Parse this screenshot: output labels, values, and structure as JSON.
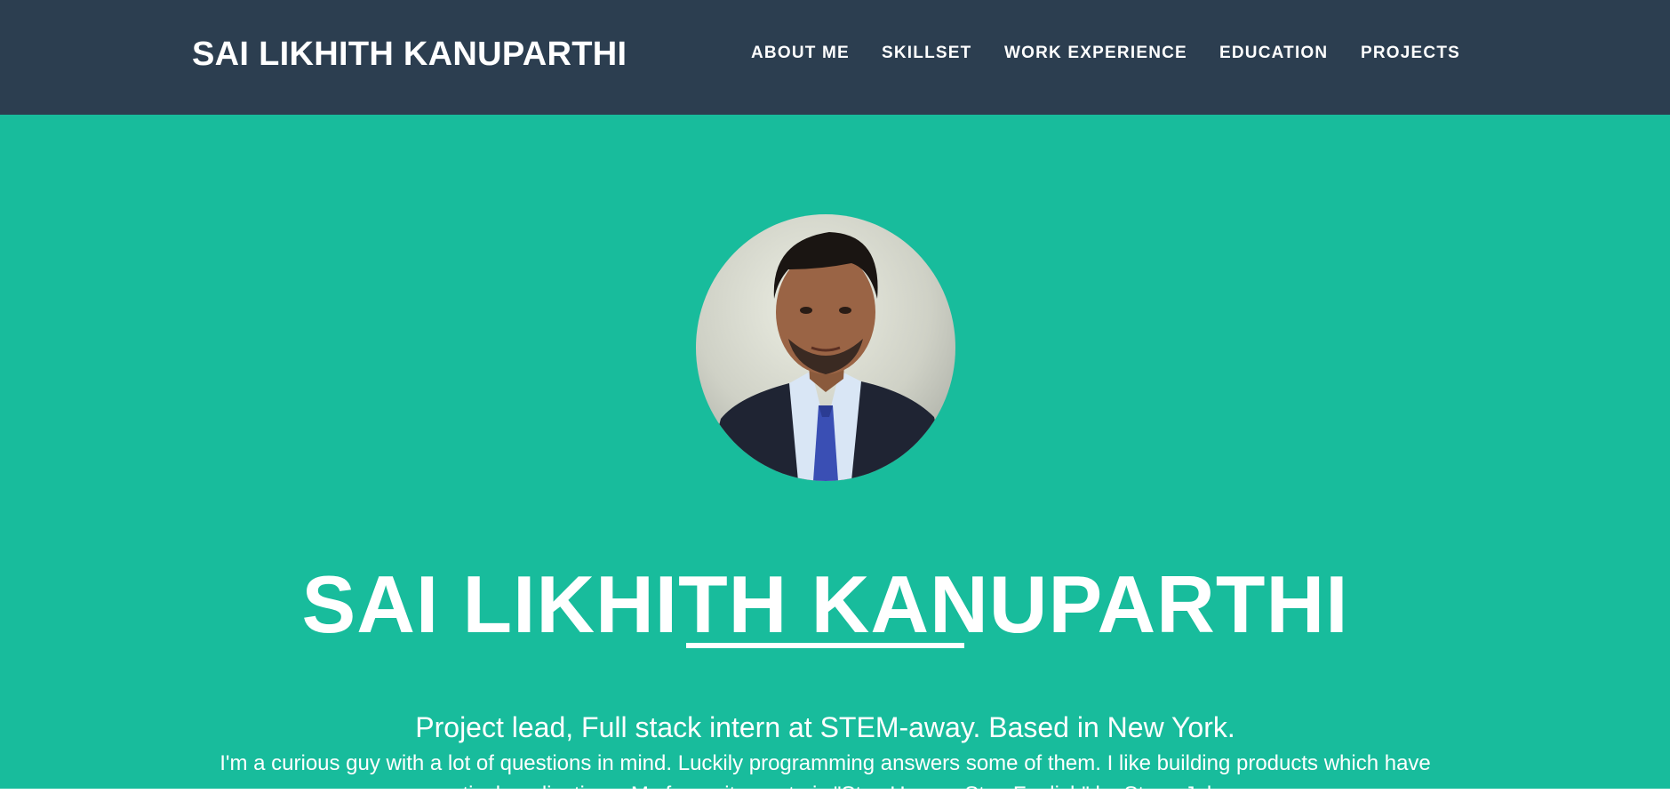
{
  "navbar": {
    "brand": "SAI LIKHITH KANUPARTHI",
    "links": [
      {
        "label": "ABOUT ME"
      },
      {
        "label": "SKILLSET"
      },
      {
        "label": "WORK EXPERIENCE"
      },
      {
        "label": "EDUCATION"
      },
      {
        "label": "PROJECTS"
      }
    ]
  },
  "masthead": {
    "avatar_icon": "profile-photo",
    "name": "SAI LIKHITH KANUPARTHI",
    "subtitle": "Project lead, Full stack intern at STEM-away. Based in New York.",
    "bio": "I'm a curious guy with a lot of questions in mind. Luckily programming answers some of them. I like building products which have practical applications. My favourite quote is \"Stay Hungry Stay Foolish\" by Steve Jobs"
  },
  "colors": {
    "navbar_bg": "#2c3e50",
    "masthead_bg": "#18bc9c",
    "text": "#ffffff"
  }
}
